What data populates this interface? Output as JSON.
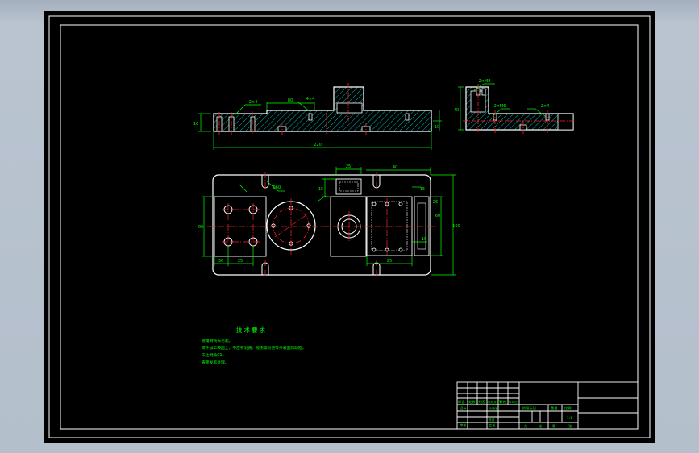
{
  "colors": {
    "background": "#000000",
    "outline": "#ffffff",
    "dimension": "#00ff00",
    "centerline": "#ff2020",
    "hatch": "#00e5e5",
    "text": "#00ff00"
  },
  "drawing": {
    "dims": {
      "front_total": "220",
      "front_partial": "80",
      "front_height": "16",
      "front_right_height": "10",
      "front_callout_a": "2×4",
      "front_callout_b": "4×4",
      "side_height": "40",
      "side_callout_a": "2×M8",
      "side_callout_b": "2×M6",
      "side_callout_c": "2×4",
      "plan_width_a": "25",
      "plan_width_b": "40",
      "plan_height": "100",
      "plan_height_b": "60",
      "plan_left_a": "36",
      "plan_left_b": "25",
      "plan_left_h": "60",
      "plan_circle": "Φ60",
      "plan_bottom_a": "25",
      "plan_bottom_b": "15",
      "plan_right_a": "15",
      "plan_right_b": "10",
      "plan_right_c": "26"
    },
    "notes": {
      "title": "技术要求",
      "lines": [
        "锐角倒钝去毛刺。",
        "零件加工表面上，不应有划痕、擦伤等损伤零件表面的缺陷。",
        "未注倒角C1。",
        "表面发黑处理。"
      ]
    },
    "title_block": {
      "row_a": [
        "标记",
        "处数",
        "分区",
        "更改文件号",
        "签名",
        "年月日"
      ],
      "row_b": [
        "设计",
        "标准化"
      ],
      "row_c": [
        "阶段标记",
        "重量",
        "比例"
      ],
      "row_d": [
        "审核",
        "工艺",
        "批准"
      ],
      "row_e": [
        "共",
        "张",
        "第",
        "张"
      ],
      "scale": "1:1"
    }
  }
}
